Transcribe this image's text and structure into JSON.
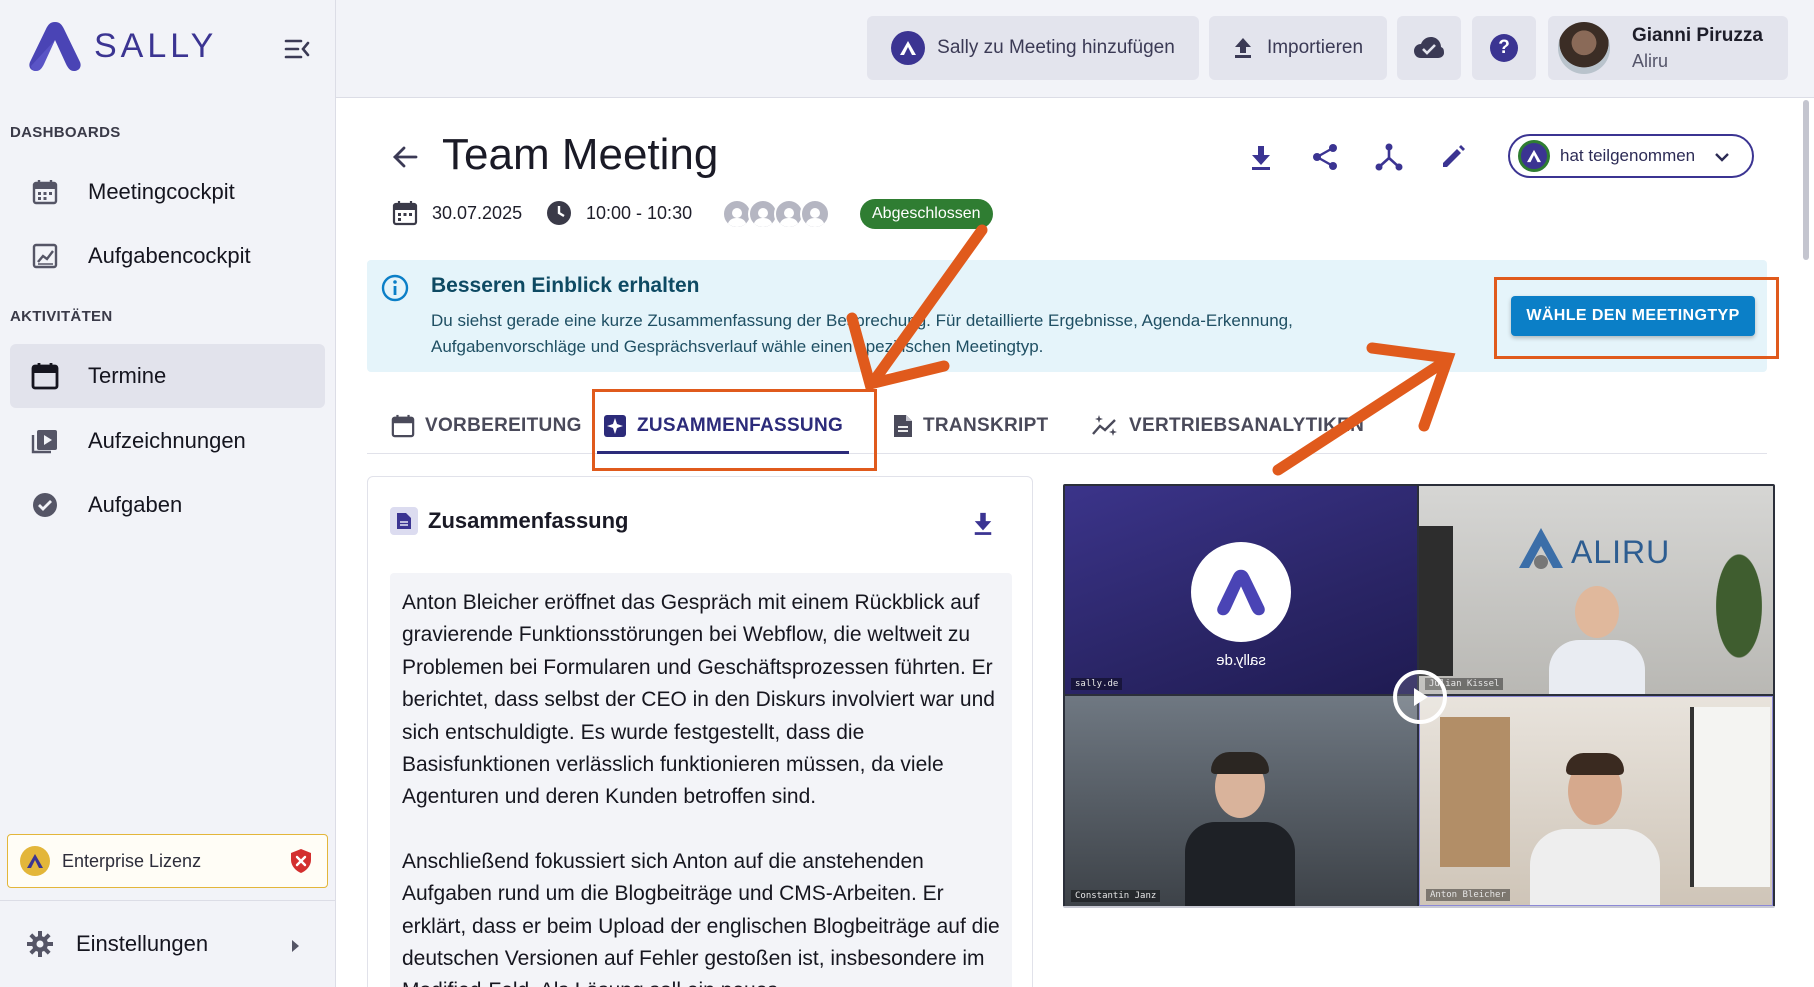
{
  "brand": {
    "name": "SALLY"
  },
  "sidebar": {
    "section_dashboards": "DASHBOARDS",
    "section_activities": "AKTIVITÄTEN",
    "items": [
      {
        "label": "Meetingcockpit",
        "icon": "calendar-icon"
      },
      {
        "label": "Aufgabencockpit",
        "icon": "chart-icon"
      },
      {
        "label": "Termine",
        "icon": "calendar-icon",
        "active": true
      },
      {
        "label": "Aufzeichnungen",
        "icon": "video-icon"
      },
      {
        "label": "Aufgaben",
        "icon": "check-circle-icon"
      }
    ],
    "license": "Enterprise Lizenz",
    "settings": "Einstellungen"
  },
  "topbar": {
    "add_sally": "Sally zu Meeting hinzufügen",
    "import": "Importieren",
    "user_name": "Gianni Piruzza",
    "user_org": "Aliru"
  },
  "meeting": {
    "title": "Team Meeting",
    "date": "30.07.2025",
    "time": "10:00 - 10:30",
    "status": "Abgeschlossen",
    "attendance": "hat teilgenommen"
  },
  "banner": {
    "title": "Besseren Einblick erhalten",
    "text": "Du siehst gerade eine kurze Zusammenfassung der Besprechung. Für detaillierte Ergebnisse, Agenda-Erkennung, Aufgabenvorschläge und Gesprächsverlauf wähle einen spezifischen Meetingtyp.",
    "button": "WÄHLE DEN MEETINGTYP"
  },
  "tabs": [
    {
      "label": "VORBEREITUNG"
    },
    {
      "label": "ZUSAMMENFASSUNG",
      "active": true
    },
    {
      "label": "TRANSKRIPT"
    },
    {
      "label": "VERTRIEBSANALYTIKEN"
    }
  ],
  "summary": {
    "title": "Zusammenfassung",
    "p1": "Anton Bleicher eröffnet das Gespräch mit einem Rückblick auf gravierende Funktionsstörungen bei Webflow, die weltweit zu Problemen bei Formularen und Geschäftsprozessen führten. Er berichtet, dass selbst der CEO in den Diskurs involviert war und sich entschuldigte. Es wurde festgestellt, dass die Basisfunktionen verlässlich funktionieren müssen, da viele Agenturen und deren Kunden betroffen sind.",
    "p2": "Anschließend fokussiert sich Anton auf die anstehenden Aufgaben rund um die Blogbeiträge und CMS-Arbeiten. Er erklärt, dass er beim Upload der englischen Blogbeiträge auf die deutschen Versionen auf Fehler gestoßen ist, insbesondere im Modified-Feld. Als Lösung soll ein neues"
  },
  "video": {
    "tile1_logo": "sally.de",
    "tile2_logo": "ALIRU",
    "tag1": "sally.de",
    "tag2": "Julian Kissel",
    "tag3": "Constantin Janz",
    "tag4": "Anton Bleicher"
  },
  "colors": {
    "brand": "#3b3492",
    "accent": "#0b7fc7",
    "status_green": "#2f7d32",
    "highlight": "#e05a1c",
    "banner_bg": "#e5f4fa"
  }
}
